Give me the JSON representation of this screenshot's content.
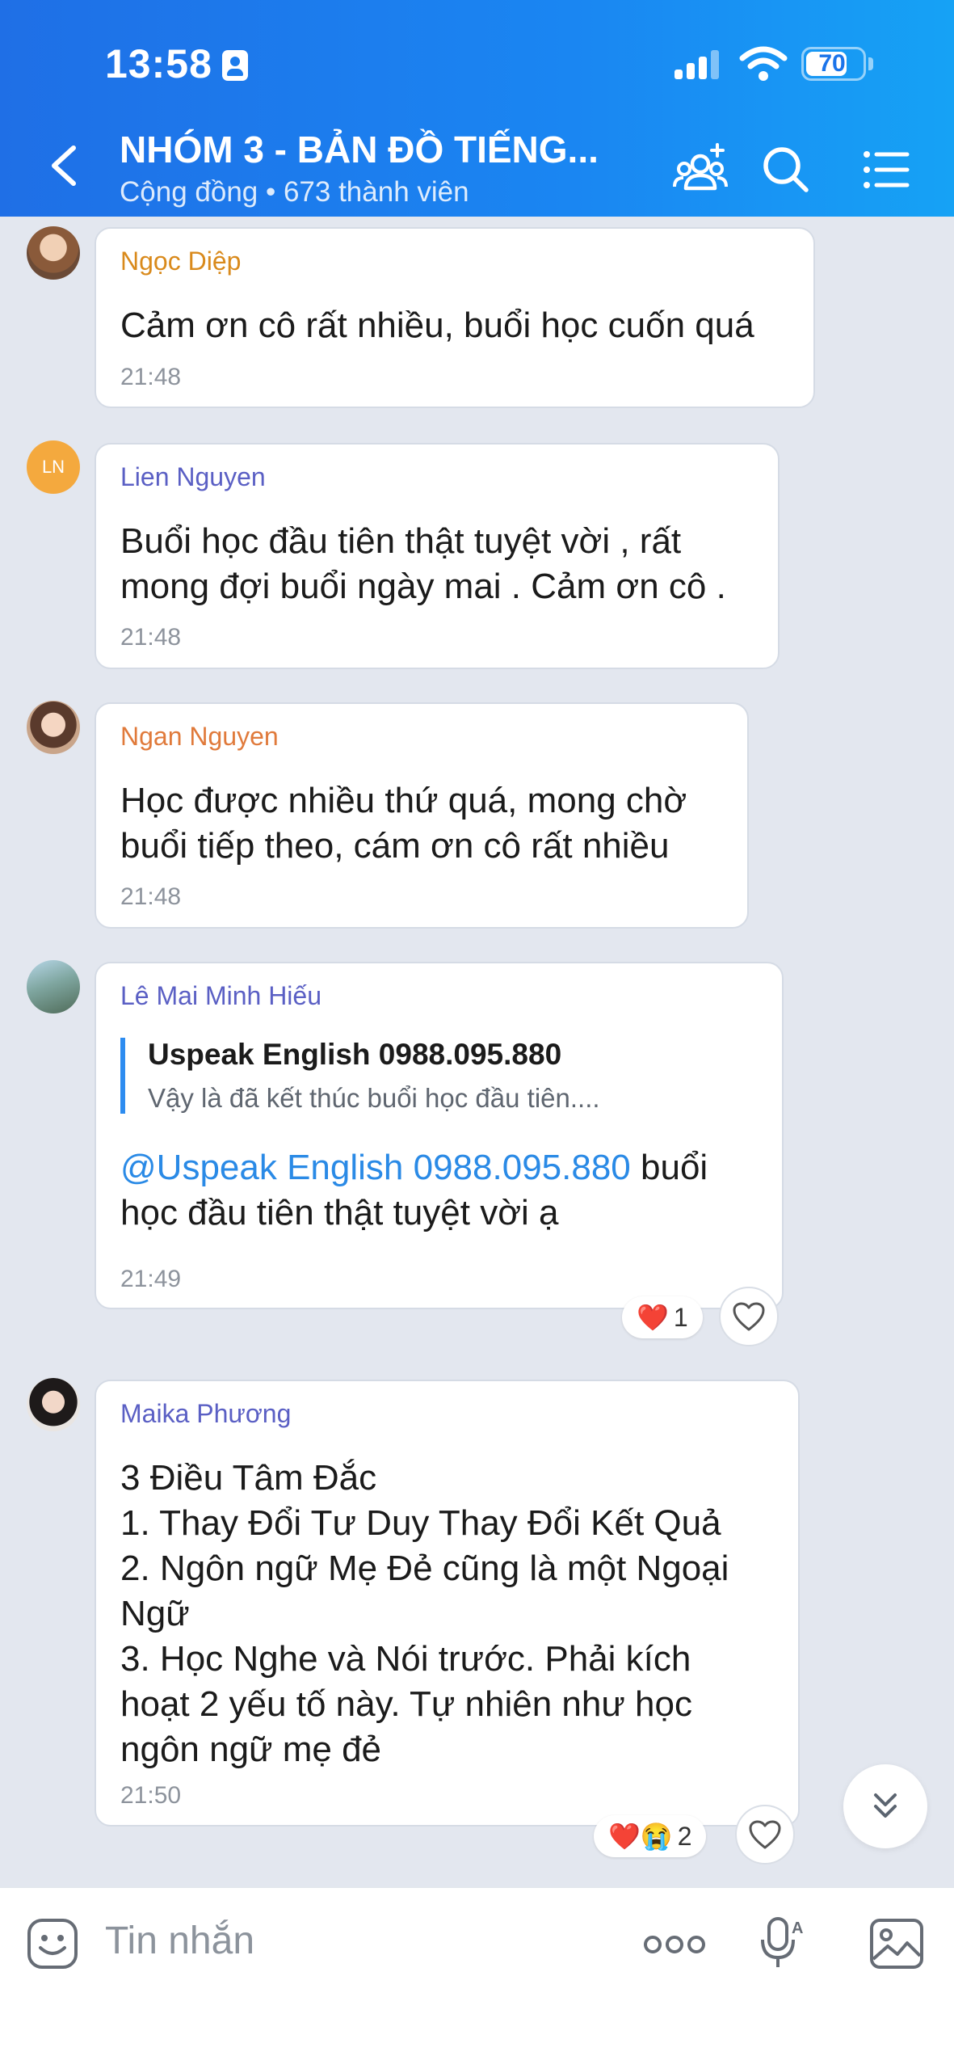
{
  "status_bar": {
    "time": "13:58",
    "battery": "70"
  },
  "header": {
    "title": "NHÓM 3 - BẢN ĐỒ TIẾNG...",
    "subtitle": "Cộng đồng • 673 thành viên"
  },
  "messages": [
    {
      "sender": "Ngọc Diệp",
      "sender_color": "#d98a1c",
      "text": "Cảm ơn cô rất nhiều, buổi học cuốn quá",
      "time": "21:48"
    },
    {
      "sender": "Lien Nguyen",
      "sender_color": "#5a5fc4",
      "avatar_initials": "LN",
      "avatar_color": "#f4a93e",
      "text": "Buổi học đầu tiên thật tuyệt vời , rất\nmong đợi buổi ngày mai . Cảm ơn cô .",
      "time": "21:48"
    },
    {
      "sender": "Ngan Nguyen",
      "sender_color": "#e07a3b",
      "text": "Học được nhiều thứ quá, mong chờ\nbuổi tiếp theo, cám ơn cô rất nhiều",
      "time": "21:48"
    },
    {
      "sender": "Lê Mai Minh Hiếu",
      "sender_color": "#5a5fc4",
      "quote": {
        "title": "Uspeak English 0988.095.880",
        "text": "Vậy là đã kết thúc buổi học đầu tiên...."
      },
      "mention": "@Uspeak English 0988.095.880",
      "text_after_mention": " buổi",
      "text_line2": "học đầu tiên thật tuyệt vời ạ",
      "time": "21:49",
      "reactions": {
        "emojis": "❤️",
        "count": "1"
      }
    },
    {
      "sender": "Maika Phương",
      "sender_color": "#5a5fc4",
      "text": "3 Điều Tâm Đắc\n1. Thay Đổi Tư Duy Thay Đổi Kết Quả\n2. Ngôn ngữ Mẹ Đẻ cũng là một Ngoại\nNgữ\n3. Học Nghe và Nói trước. Phải kích\nhoạt 2 yếu tố này. Tự nhiên như học\nngôn ngữ mẹ đẻ",
      "time": "21:50",
      "reactions": {
        "emojis": "❤️😭",
        "count": "2"
      }
    }
  ],
  "input": {
    "placeholder": "Tin nhắn"
  }
}
